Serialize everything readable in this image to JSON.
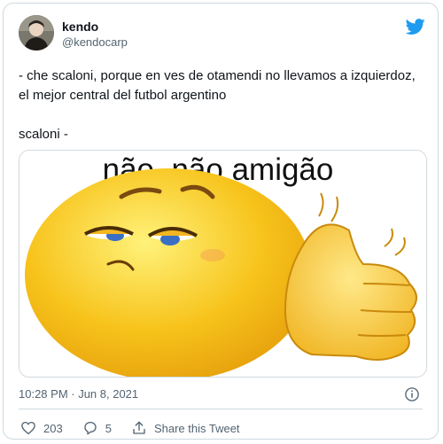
{
  "author": {
    "name": "kendo",
    "handle": "@kendocarp"
  },
  "tweet": {
    "lines": [
      "- che scaloni, porque en ves de otamendi no llevamos a izquierdoz, el mejor central del futbol argentino"
    ],
    "reply": "scaloni -"
  },
  "media": {
    "caption": "não, não amigão",
    "icon": "smirking-thumbs-up-emoji"
  },
  "timestamp": "10:28 PM · Jun 8, 2021",
  "actions": {
    "likes": "203",
    "replies": "5",
    "share_label": "Share this Tweet"
  },
  "colors": {
    "brand": "#1d9bf0",
    "muted": "#536471",
    "border": "#cfd9de",
    "emoji": "#f7c31b"
  },
  "icons": {
    "logo": "twitter-bird-icon",
    "info": "info-icon",
    "like": "heart-icon",
    "reply": "reply-icon",
    "share": "share-icon"
  }
}
